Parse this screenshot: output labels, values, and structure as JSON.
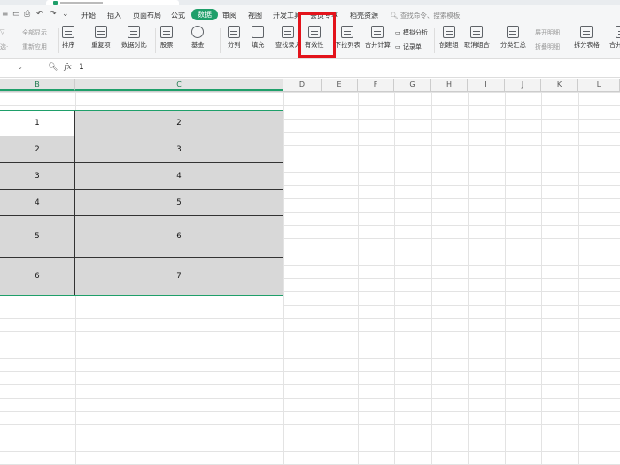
{
  "menubar": {
    "tabs": [
      "开始",
      "插入",
      "页面布局",
      "公式",
      "数据",
      "审阅",
      "视图",
      "开发工具",
      "会员专享",
      "稻壳资源"
    ],
    "active_tab": "数据",
    "search_placeholder": "查找命令、搜索模板"
  },
  "ribbon": {
    "filter_small": [
      "全部显示",
      "重新应用"
    ],
    "buttons": [
      "排序",
      "重复项",
      "数据对比",
      "股票",
      "基金",
      "分列",
      "填充",
      "查找录入",
      "有效性",
      "下拉列表",
      "合并计算",
      "记录单",
      "创建组",
      "取消组合",
      "分类汇总",
      "拆分表格",
      "合并表格"
    ],
    "small_items": [
      "模拟分析",
      "展开明细",
      "折叠明细"
    ]
  },
  "formula_bar": {
    "fx_label": "fx",
    "value": "1"
  },
  "columns": [
    "B",
    "C",
    "D",
    "E",
    "F",
    "G",
    "H",
    "I",
    "J",
    "K",
    "L"
  ],
  "table": {
    "col_b": [
      "1",
      "2",
      "3",
      "4",
      "5",
      "6"
    ],
    "col_c": [
      "2",
      "3",
      "4",
      "5",
      "6",
      "7"
    ]
  },
  "colors": {
    "accent": "#1f9f6a",
    "highlight_box": "#e3131b",
    "selected_fill": "#d8d8d8"
  }
}
